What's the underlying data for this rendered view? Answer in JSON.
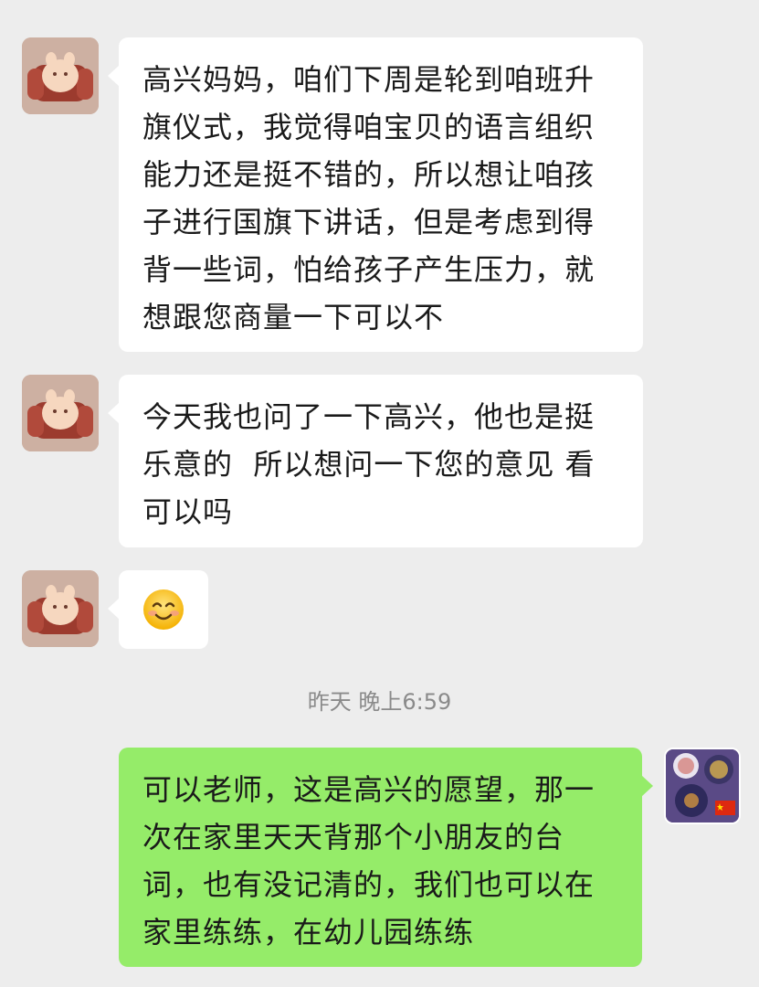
{
  "messages": [
    {
      "id": "m1",
      "side": "left",
      "text": "高兴妈妈，咱们下周是轮到咱班升旗仪式，我觉得咱宝贝的语言组织能力还是挺不错的，所以想让咱孩子进行国旗下讲话，但是考虑到得背一些词，怕给孩子产生压力，就想跟您商量一下可以不"
    },
    {
      "id": "m2",
      "side": "left",
      "text": "今天我也问了一下高兴，他也是挺乐意的  所以想问一下您的意见 看可以吗"
    },
    {
      "id": "m3",
      "side": "left",
      "emoji": "smile-emoji"
    },
    {
      "id": "m4",
      "side": "right",
      "text": "可以老师，这是高兴的愿望，那一次在家里天天背那个小朋友的台词，也有没记清的，我们也可以在家里练练，在幼儿园练练"
    }
  ],
  "timestamp": "昨天 晚上6:59",
  "colors": {
    "background": "#ededed",
    "incoming_bubble": "#ffffff",
    "outgoing_bubble": "#95ec69",
    "timestamp_text": "#8a8a8a"
  }
}
